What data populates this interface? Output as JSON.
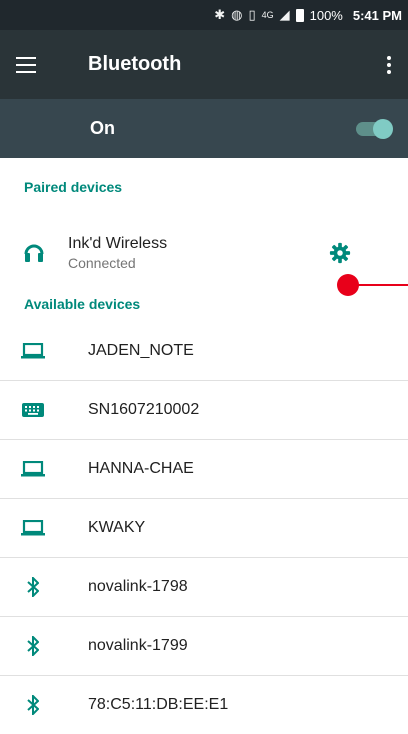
{
  "status_bar": {
    "battery_percent": "100%",
    "time": "5:41 PM",
    "network": "4G",
    "icons": [
      "bluetooth-icon",
      "nfc-icon",
      "vibrate-icon",
      "signal-icon",
      "battery-icon"
    ]
  },
  "app_bar": {
    "title": "Bluetooth",
    "menu_icon": "hamburger-menu-icon",
    "overflow_icon": "more-vert-icon"
  },
  "toggle_bar": {
    "label": "On",
    "state": true
  },
  "paired": {
    "header": "Paired devices",
    "devices": [
      {
        "name": "Ink'd Wireless",
        "status": "Connected",
        "icon": "headset-icon",
        "settings_icon": "gear-icon"
      }
    ]
  },
  "available": {
    "header": "Available devices",
    "devices": [
      {
        "name": "JADEN_NOTE",
        "icon": "laptop-icon"
      },
      {
        "name": "SN1607210002",
        "icon": "keyboard-icon"
      },
      {
        "name": "HANNA-CHAE",
        "icon": "laptop-icon"
      },
      {
        "name": "KWAKY",
        "icon": "laptop-icon"
      },
      {
        "name": "novalink-1798",
        "icon": "bluetooth-icon"
      },
      {
        "name": "novalink-1799",
        "icon": "bluetooth-icon"
      },
      {
        "name": "78:C5:11:DB:EE:E1",
        "icon": "bluetooth-icon"
      }
    ]
  },
  "colors": {
    "accent": "#00897b",
    "app_bar": "#2a3438",
    "toggle_bar": "#37474f",
    "status_bar": "#20282d",
    "touch_indicator": "#e8001a"
  }
}
